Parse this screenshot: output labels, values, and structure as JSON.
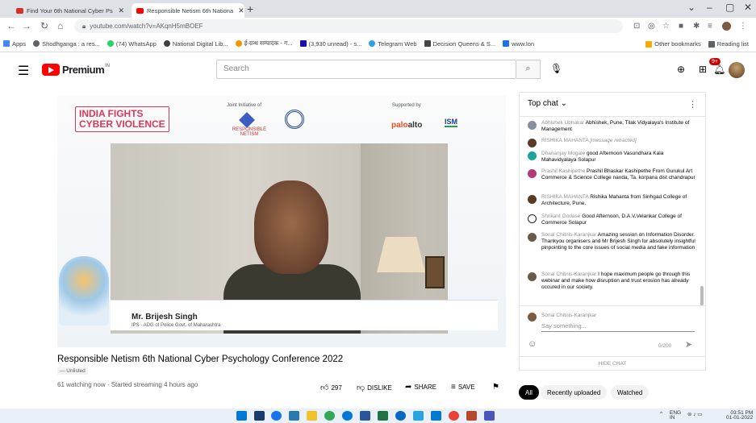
{
  "tabs": [
    {
      "title": "Find Your 6th National Cyber Ps",
      "close": "✕",
      "color": "#d93025"
    },
    {
      "title": "Responsible Netism 6th Nationa",
      "close": "✕",
      "color": "#ff0000"
    }
  ],
  "newtab": "+",
  "window": {
    "minimize": "–",
    "maximize": "▢",
    "close": "✕",
    "chevron": "⌄"
  },
  "nav": {
    "back": "←",
    "forward": "→",
    "reload": "↻",
    "home": "⌂"
  },
  "address": {
    "url": "youtube.com/watch?v=AKqnH5mBOEF"
  },
  "bookmarks": [
    {
      "label": "Apps",
      "color": "#4285f4"
    },
    {
      "label": "Shodhganga : a res...",
      "color": "#5f6368"
    },
    {
      "label": "(74) WhatsApp",
      "color": "#25d366"
    },
    {
      "label": "National Digital Lib...",
      "color": "#3c4043"
    },
    {
      "label": "ई-ग्रन्थ सम्पादक - ग...",
      "color": "#f29900"
    },
    {
      "label": "(3,930 unread) - s...",
      "color": "#1a0dab"
    },
    {
      "label": "Telegram Web",
      "color": "#2aa3e0"
    },
    {
      "label": "Decision Queens & S...",
      "color": "#444"
    },
    {
      "label": "www.lon",
      "color": "#1a73e8"
    }
  ],
  "bookmarks_right": [
    "Other bookmarks",
    "Reading list"
  ],
  "yt": {
    "brand": "Premium",
    "brand_sup": "IN",
    "search_placeholder": "Search",
    "notif_count": "9+"
  },
  "video": {
    "banner_line1": "INDIA FIGHTS",
    "banner_line2": "CYBER VIOLENCE",
    "joint_label": "Joint Initiative of",
    "supported_label": "Supported by",
    "rn_logo": "RESPONSIBLE NETISM",
    "palo_a": "palo",
    "palo_b": "alto",
    "ism": "ISM",
    "speaker_name": "Mr. Brijesh Singh",
    "speaker_role": "IPS - ADG of Police Govt. of Maharashtra"
  },
  "title": "Responsible Netism 6th National Cyber Psychology Conference 2022",
  "hashtag": "— Unlisted",
  "watching": "61 watching now · Started streaming 4 hours ago",
  "actions": {
    "likes": "297",
    "dislike": "DISLIKE",
    "share": "SHARE",
    "save": "SAVE",
    "flag": "⚑"
  },
  "chat": {
    "header": "Top chat",
    "more": "⋮",
    "messages": [
      {
        "author": "Abhishek Ubhakar",
        "text": "Abhishek, Pune, Tilak Vidyalaya's Institute of Management",
        "color": "#8a8fa0"
      },
      {
        "author": "RISHIKA MAHANTA",
        "text": "[message retracted]",
        "color": "#5a3a25"
      },
      {
        "author": "Dhananjay Mogale",
        "text": "good Afternoon Vasundhara Kala Mahavidyalaya Solapur",
        "color": "#1ba39c"
      },
      {
        "author": "Prashil Kashipethe",
        "text": "Prashil Bhaskar Kashipethe From Gurukul Art Commerce & Science College nanda, Ta. korpana dist chandrapur",
        "color": "#b23a7a"
      },
      {
        "author": "RISHIKA MAHANTA",
        "text": "Rishika Mahanta from Sinhgad College of Architecture, Pune.",
        "color": "#5a3a25"
      },
      {
        "author": "Shrikant Godase",
        "text": "Good Afternoon, D.A.V.Velankar College of Commerce Solapur",
        "color": "#222"
      },
      {
        "author": "Sonal Chitnis-Karanjkar",
        "text": "Amazing session on Information Disorder. Thankyou organisers and Mr Brijesh Singh for absolutely insightful pinpointing to the core issues of social media and fake information",
        "color": "#6a5a4a"
      },
      {
        "author": "Sonal Chitnis-Karanjkar",
        "text": "I hope maximum people go through this webinar and make how disruption and trust erosion has already occured in our society.",
        "color": "#6a5a4a"
      }
    ],
    "input_name": "Sonal Chitnis-Karanjkar",
    "input_placeholder": "Say something...",
    "counter": "0/200",
    "hide": "HIDE CHAT"
  },
  "chips": [
    "All",
    "Recently uploaded",
    "Watched"
  ],
  "tray": {
    "lang": "ENG",
    "region": "IN",
    "time": "03:51 PM",
    "date": "01-01-2022"
  }
}
